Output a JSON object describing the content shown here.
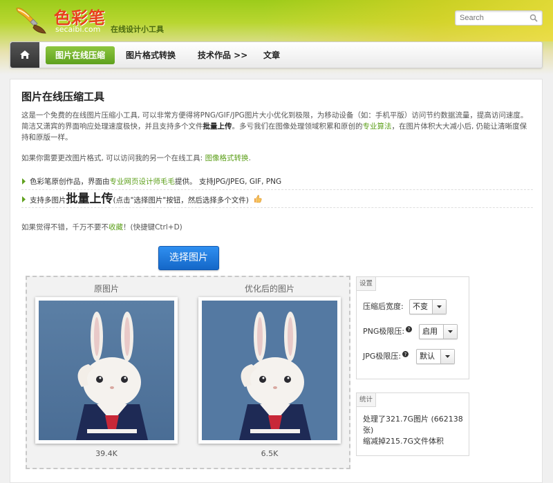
{
  "header": {
    "logo_text": "色彩笔",
    "domain": "secaibi.com",
    "slogan": "在线设计小工具",
    "search_placeholder": "Search"
  },
  "nav": {
    "home_icon": "home-icon",
    "items": [
      {
        "label": "图片在线压缩",
        "active": true
      },
      {
        "label": "图片格式转换",
        "active": false
      },
      {
        "label": "技术作品 >>",
        "active": false
      },
      {
        "label": "文章",
        "active": false
      }
    ]
  },
  "main": {
    "title": "图片在线压缩工具",
    "intro_part1": "这是一个免费的在线图片压缩小工具, 可以非常方便得将PNG/GIF/JPG图片大小优化到极限，为移动设备（如：手机平版）访问节约数据流量，提高访问速度。简洁又潇宾的界面响应处理速度极快，并且支持多个文件",
    "intro_bold": "批量上传",
    "intro_part2": "。多亏我们在图像处理领域积累和原创的",
    "intro_link": "专业算法",
    "intro_part3": "，在图片体积大大减小后, 仍能让清晰度保持和原版一样。",
    "format_text": "如果你需要更改图片格式, 可以访问我的另一个在线工具: ",
    "format_link": "图像格式转换",
    "format_end": ".",
    "feature1_part1": "色彩笔原创作品，界面由",
    "feature1_link": "专业网页设计师毛毛",
    "feature1_part2": "提供。 支持JPG/JPEG, GIF, PNG",
    "feature2_part1": "支持多图片",
    "feature2_big": "批量上传",
    "feature2_part2": "(点击\"选择图片\"按钮，然后选择多个文件)",
    "bookmark_part1": "如果觉得不错，千万不要不",
    "bookmark_link": "收藏",
    "bookmark_part2": "！(快捷键Ctrl+D)",
    "select_button": "选择图片"
  },
  "compare": {
    "original_label": "原图片",
    "optimized_label": "优化后的图片",
    "original_size": "39.4K",
    "optimized_size": "6.5K"
  },
  "settings": {
    "title": "设置",
    "width_label": "压缩后宽度:",
    "width_value": "不变",
    "png_label": "PNG极限压:",
    "png_value": "启用",
    "jpg_label": "JPG极限压:",
    "jpg_value": "默认"
  },
  "stats": {
    "title": "统计",
    "line1": "处理了321.7G图片 (662138张)",
    "line2": "缩减掉215.7G文件体积"
  },
  "colors": {
    "accent_green": "#5fa11e",
    "button_blue": "#1f7ee0",
    "logo_red": "#e8401c"
  }
}
